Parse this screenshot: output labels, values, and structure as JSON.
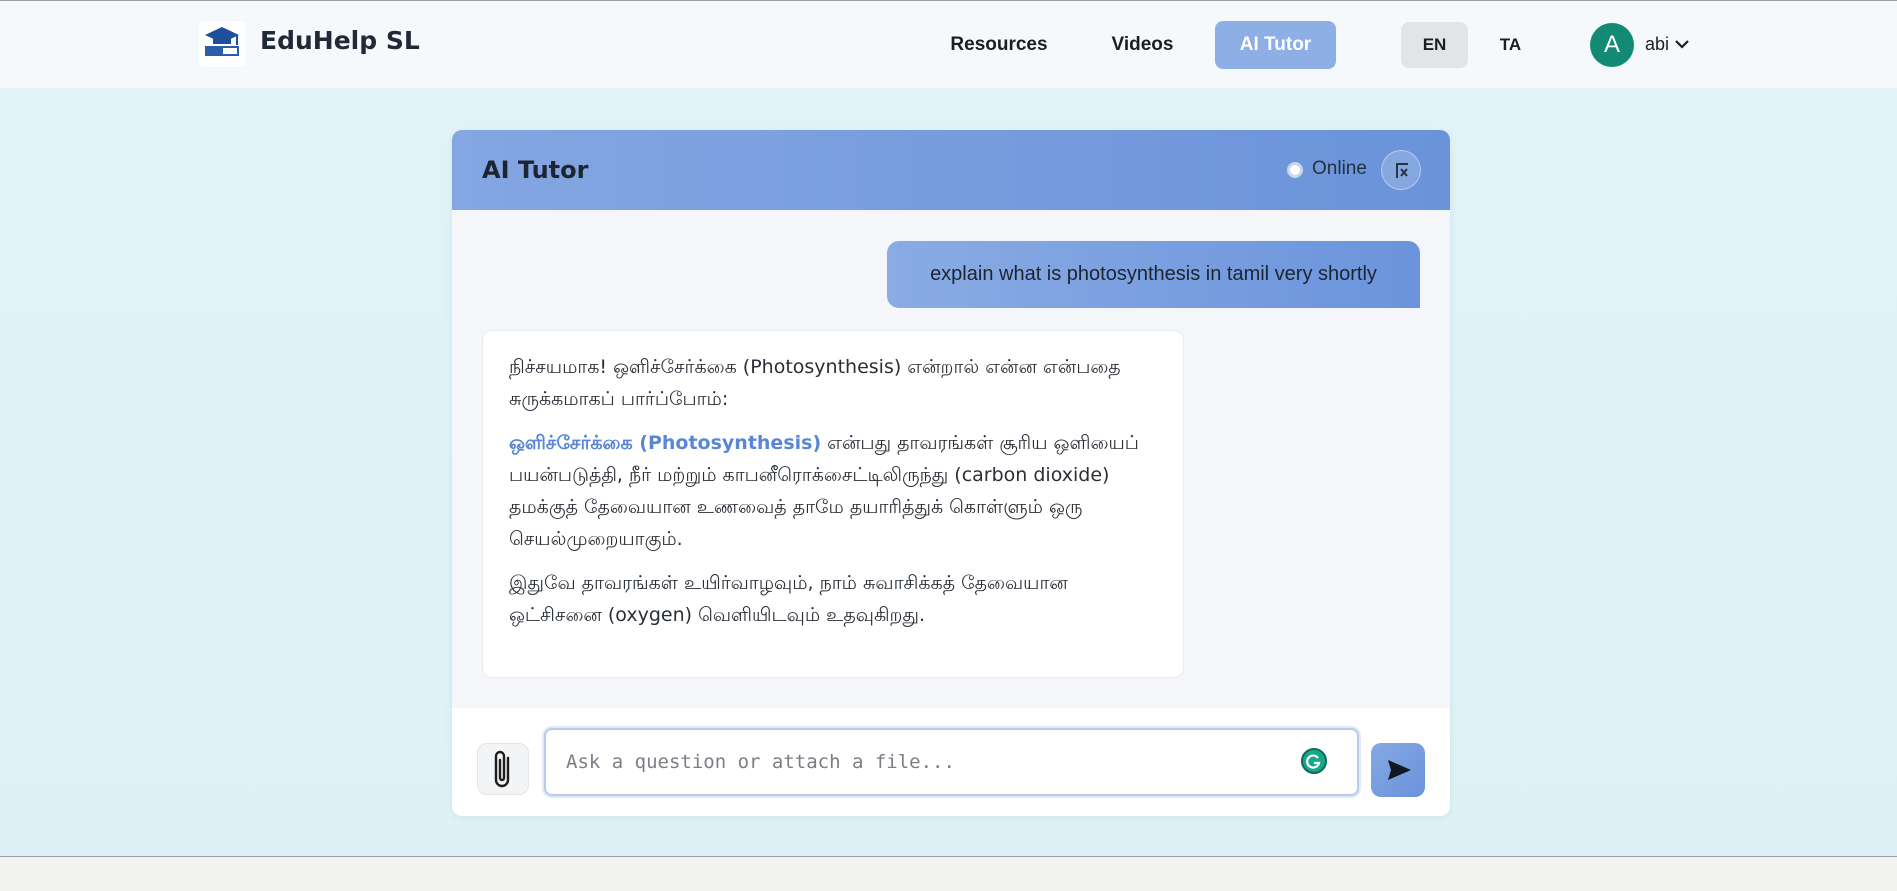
{
  "app": {
    "name": "EduHelp SL"
  },
  "nav": {
    "links": [
      {
        "label": "Resources"
      },
      {
        "label": "Videos"
      },
      {
        "label": "AI Tutor",
        "active": true
      }
    ],
    "languages": [
      {
        "label": "EN",
        "active": true
      },
      {
        "label": "TA"
      }
    ],
    "user": {
      "initial": "A",
      "name": "abi",
      "avatar_color": "#138a74"
    }
  },
  "chat": {
    "title": "AI Tutor",
    "status": "Online",
    "messages": [
      {
        "role": "user",
        "text": "explain what is photosynthesis in tamil very shortly"
      },
      {
        "role": "assistant",
        "paragraphs": [
          {
            "text": "நிச்சயமாக! ஒளிச்சேர்க்கை (Photosynthesis) என்றால் என்ன என்பதை சுருக்கமாகப் பார்ப்போம்:"
          },
          {
            "highlight": "ஒளிச்சேர்க்கை (Photosynthesis)",
            "text": " என்பது தாவரங்கள் சூரிய ஒளியைப் பயன்படுத்தி, நீர் மற்றும் காபனீரொக்சைட்டிலிருந்து (carbon dioxide) தமக்குத் தேவையான உணவைத் தாமே தயாரித்துக் கொள்ளும் ஒரு செயல்முறையாகும்."
          },
          {
            "text": "இதுவே தாவரங்கள் உயிர்வாழவும், நாம் சுவாசிக்கத் தேவையான ஒட்சிசனை (oxygen) வெளியிடவும் உதவுகிறது."
          }
        ]
      }
    ],
    "input": {
      "placeholder": "Ask a question or attach a file...",
      "value": ""
    }
  },
  "colors": {
    "accent": "#6a93da",
    "highlight": "#5a86d6",
    "avatar": "#138a74",
    "background": "#e0f4f7"
  },
  "icons": [
    "graduation-cap-logo-icon",
    "chevron-down-icon",
    "clear-chat-icon",
    "paperclip-icon",
    "grammarly-icon",
    "send-icon"
  ]
}
